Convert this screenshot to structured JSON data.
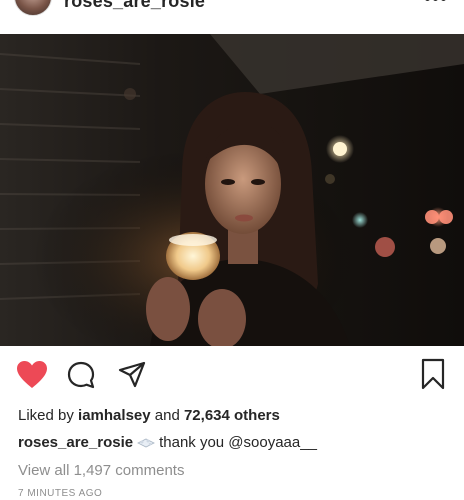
{
  "header": {
    "username": "roses_are_rosie",
    "more_icon": "more-options-icon"
  },
  "post": {
    "photo_icon": "post-photo",
    "actions": {
      "like_icon": "heart-icon",
      "liked": true,
      "like_color": "#ed4956",
      "comment_icon": "comment-icon",
      "share_icon": "share-icon",
      "save_icon": "bookmark-icon"
    },
    "likes": {
      "prefix": "Liked by",
      "user": "iamhalsey",
      "connector": "and",
      "count": "72,634 others"
    },
    "caption": {
      "username": "roses_are_rosie",
      "emoji": "bouquet-emoji",
      "text": "thank you @sooyaaa__"
    },
    "view_comments": "View all 1,497 comments",
    "timestamp": "7 MINUTES AGO"
  }
}
